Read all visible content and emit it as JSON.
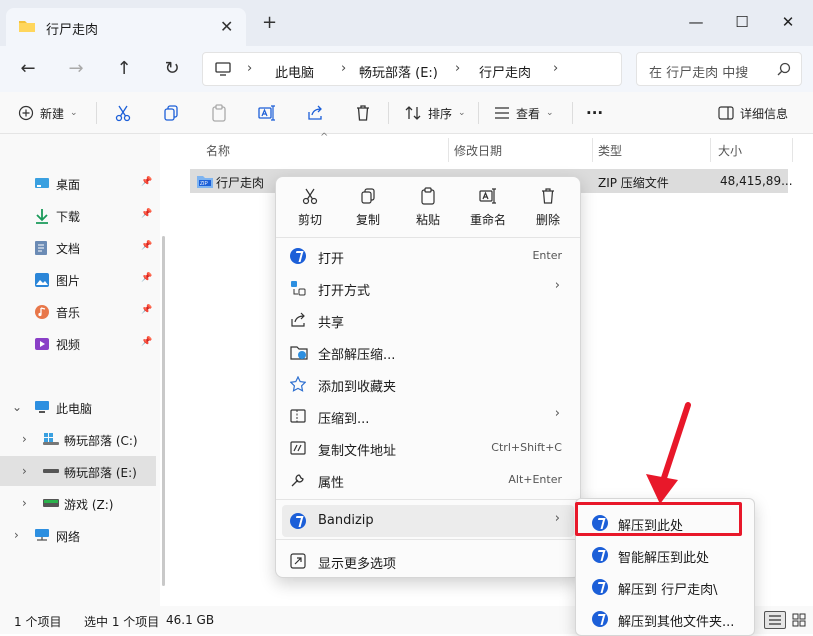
{
  "window": {
    "tab_title": "行尸走肉",
    "new_tab": "+",
    "close_tab": "✕",
    "minimize": "—",
    "maximize": "☐",
    "close": "✕"
  },
  "nav": {
    "breadcrumbs": [
      "此电脑",
      "畅玩部落 (E:)",
      "行尸走肉"
    ],
    "sep": "›",
    "search_placeholder": "在 行尸走肉 中搜"
  },
  "toolbar": {
    "new_label": "新建",
    "sort_label": "排序",
    "view_label": "查看",
    "more": "···",
    "details_label": "详细信息"
  },
  "sidebar": {
    "quick": [
      {
        "label": "桌面",
        "icon": "desktop-icon"
      },
      {
        "label": "下载",
        "icon": "download-icon"
      },
      {
        "label": "文档",
        "icon": "document-icon"
      },
      {
        "label": "图片",
        "icon": "pictures-icon"
      },
      {
        "label": "音乐",
        "icon": "music-icon"
      },
      {
        "label": "视频",
        "icon": "video-icon"
      }
    ],
    "this_pc": "此电脑",
    "drives": [
      {
        "label": "畅玩部落 (C:)",
        "selected": false
      },
      {
        "label": "畅玩部落 (E:)",
        "selected": true
      },
      {
        "label": "游戏 (Z:)",
        "selected": false
      }
    ],
    "network": "网络"
  },
  "content": {
    "columns": [
      "名称",
      "修改日期",
      "类型",
      "大小"
    ],
    "file": {
      "name": "行尸走肉",
      "type": "ZIP 压缩文件",
      "size": "48,415,89..."
    }
  },
  "status": {
    "count": "1 个项目",
    "selected": "选中 1 个项目",
    "size": "46.1 GB"
  },
  "context_menu": {
    "quick_actions": [
      "剪切",
      "复制",
      "粘贴",
      "重命名",
      "删除"
    ],
    "items": [
      {
        "label": "打开",
        "shortcut": "Enter",
        "icon": "bandizip-icon"
      },
      {
        "label": "打开方式",
        "shortcut": "",
        "icon": "open-with-icon",
        "submenu": true
      },
      {
        "label": "共享",
        "shortcut": "",
        "icon": "share-icon"
      },
      {
        "label": "全部解压缩...",
        "shortcut": "",
        "icon": "extract-all-icon"
      },
      {
        "label": "添加到收藏夹",
        "shortcut": "",
        "icon": "star-icon"
      },
      {
        "label": "压缩到...",
        "shortcut": "",
        "icon": "compress-icon",
        "submenu": true
      },
      {
        "label": "复制文件地址",
        "shortcut": "Ctrl+Shift+C",
        "icon": "copy-path-icon"
      },
      {
        "label": "属性",
        "shortcut": "Alt+Enter",
        "icon": "wrench-icon"
      }
    ],
    "bandizip": "Bandizip",
    "more_options": "显示更多选项"
  },
  "submenu": {
    "items": [
      "解压到此处",
      "智能解压到此处",
      "解压到 行尸走肉\\",
      "解压到其他文件夹..."
    ]
  },
  "accent": {
    "red_annotation": "#e8182a",
    "bandizip_blue": "#1c5fd8"
  }
}
